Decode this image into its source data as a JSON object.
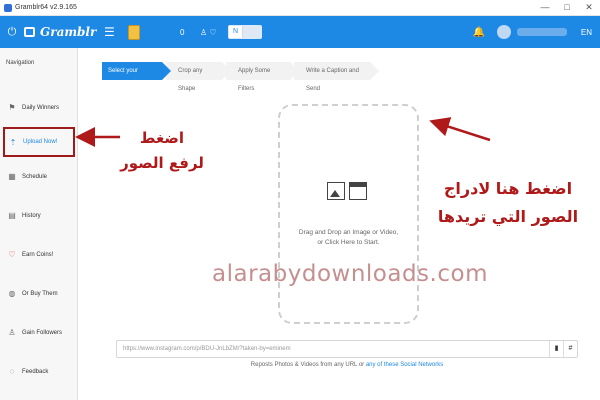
{
  "window": {
    "title": "Gramblr64 v2.9.165",
    "controls": [
      "—",
      "□",
      "✕"
    ]
  },
  "header": {
    "logo": "Gramblr",
    "power_glyph": "⏻",
    "hamburger_glyph": "☰",
    "coins": "0",
    "icons_glyph": "♙ ♡",
    "toggle_label": "N",
    "bell_glyph": "🔔",
    "language": "EN",
    "accent_color": "#1e88e5"
  },
  "sidebar": {
    "title": "Navigation",
    "items": [
      {
        "label": "Daily Winners",
        "icon": "ribbon-icon",
        "glyph": "⚑"
      },
      {
        "label": "Upload Now!",
        "icon": "upload-icon",
        "glyph": "⇡"
      },
      {
        "label": "Schedule",
        "icon": "calendar-icon",
        "glyph": "▦"
      },
      {
        "label": "History",
        "icon": "history-icon",
        "glyph": "▤"
      },
      {
        "label": "Earn Coins!",
        "icon": "heart-icon",
        "glyph": "♡"
      },
      {
        "label": "Or Buy Them",
        "icon": "cart-icon",
        "glyph": "◍"
      },
      {
        "label": "Gain Followers",
        "icon": "user-icon",
        "glyph": "♙"
      },
      {
        "label": "Feedback",
        "icon": "chat-icon",
        "glyph": "◌"
      }
    ]
  },
  "steps": [
    "Select your Media",
    "Crop any Shape",
    "Apply Some Filters",
    "Write a Caption and Send"
  ],
  "dropzone": {
    "line1": "Drag and Drop an Image or Video,",
    "line2": "or Click Here to Start."
  },
  "urlbar": {
    "placeholder": "https://www.instagram.com/p/BDU-JnLbZM/?taken-by=eminem",
    "paste_glyph": "▮",
    "hash_glyph": "#"
  },
  "repost": {
    "text": "Reposts Photos & Videos from any URL or ",
    "link": "any of these Social Networks"
  },
  "annotations": {
    "left_line1": "اضغط",
    "left_line2": "لرفع الصور",
    "right_line1": "اضغط هنا لادراج",
    "right_line2": "الصور التي تريدها",
    "color": "#b01919"
  },
  "watermark": "alarabydownloads.com"
}
